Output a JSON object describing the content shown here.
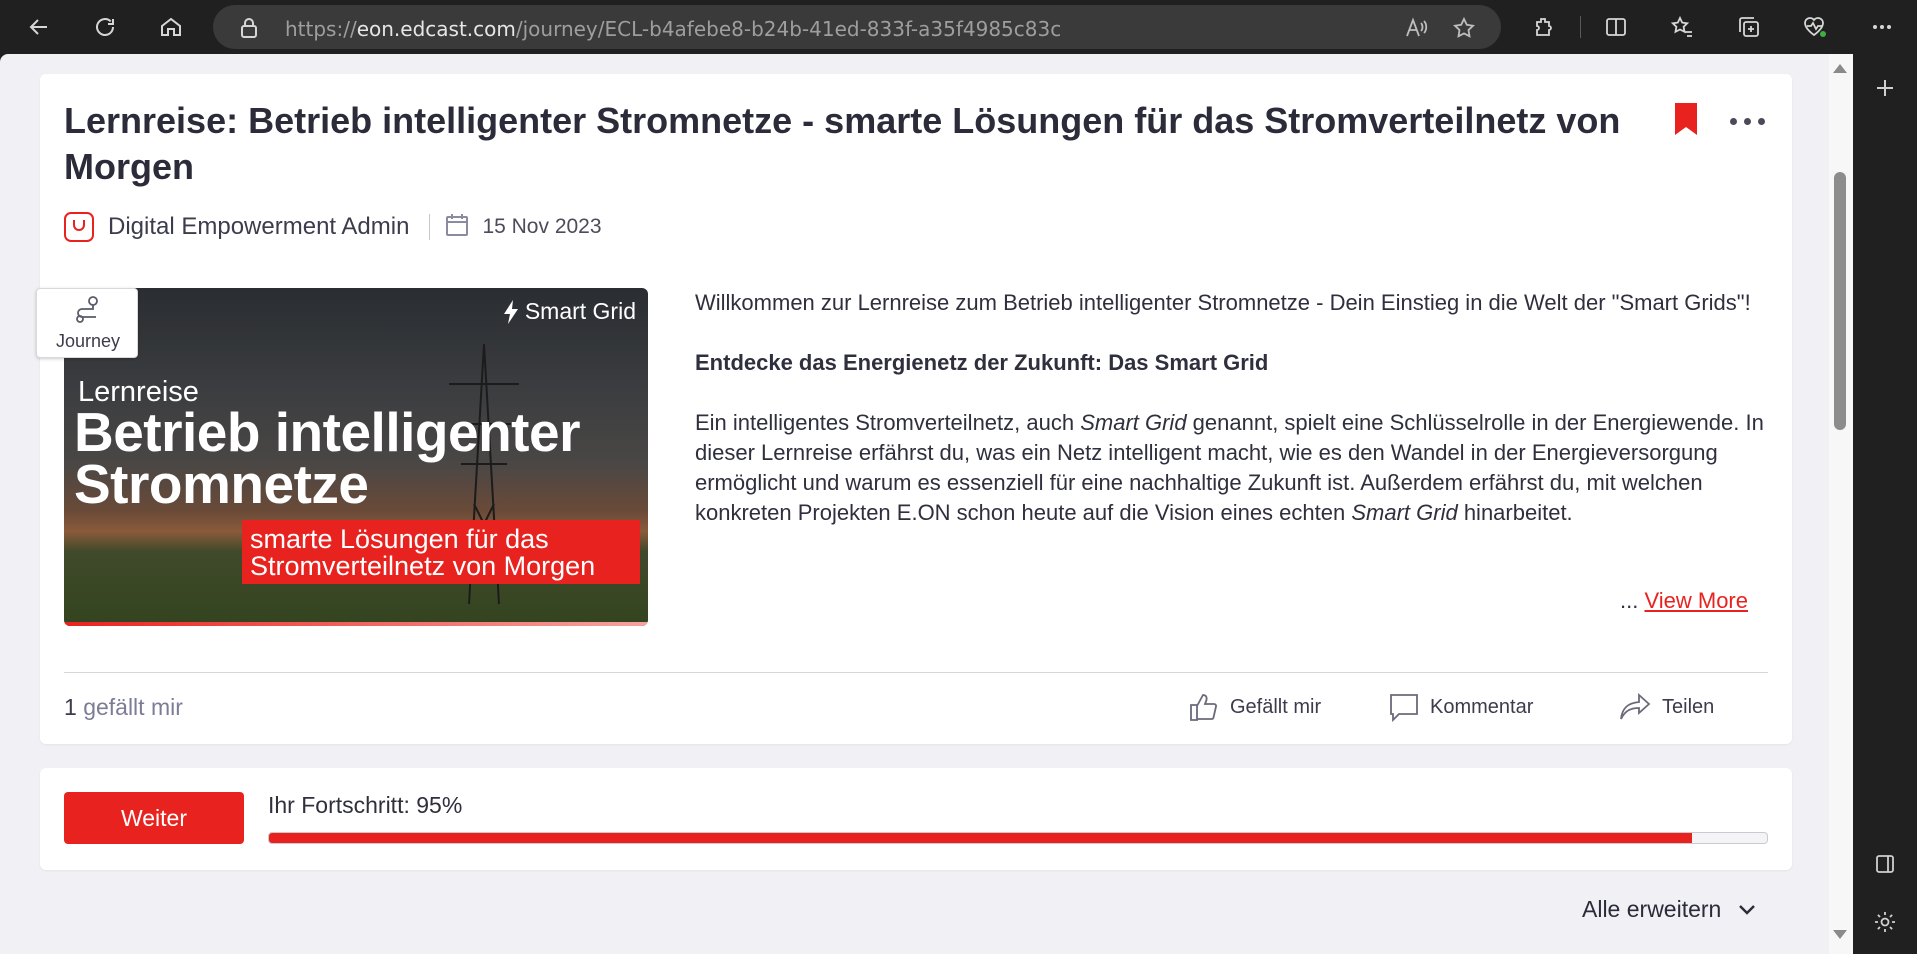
{
  "browser": {
    "url_prefix": "https://",
    "url_host": "eon.edcast.com",
    "url_path": "/journey/ECL-b4afebe8-b24b-41ed-833f-a35f4985c83c"
  },
  "card": {
    "title": "Lernreise: Betrieb intelligenter Stromnetze - smarte Lösungen für das Stromverteilnetz von Morgen",
    "author": "Digital Empowerment Admin",
    "date": "15 Nov 2023",
    "badge_label": "Journey",
    "accent_color": "#e8231f"
  },
  "hero": {
    "tag": "Smart Grid",
    "subtitle": "Lernreise",
    "headline_1": "Betrieb intelligenter",
    "headline_2": "Stromnetze",
    "red_line_1": "smarte Lösungen für das",
    "red_line_2": "Stromverteilnetz von Morgen"
  },
  "description": {
    "intro": "Willkommen zur Lernreise zum Betrieb intelligenter Stromnetze - Dein Einstieg in die Welt der \"Smart Grids\"!",
    "heading": "Entdecke das Energienetz der Zukunft: Das Smart Grid",
    "body_1": "Ein intelligentes Stromverteilnetz, auch ",
    "body_em_1": "Smart Grid",
    "body_2": " genannt, spielt eine Schlüsselrolle in der Energiewende. In dieser Lernreise erfährst du, was ein Netz intelligent macht, wie es den Wandel in der Energieversorgung ermöglicht und warum es essenziell für eine nachhaltige Zukunft ist. Außerdem erfährst du, mit welchen konkreten Projekten E.ON schon heute auf die Vision eines echten ",
    "body_em_2": "Smart Grid",
    "body_3": " hinarbeitet.",
    "ellipsis": "...",
    "view_more": "View More"
  },
  "engagement": {
    "like_count": "1",
    "like_suffix": "gefällt mir",
    "like_label": "Gefällt mir",
    "comment_label": "Kommentar",
    "share_label": "Teilen"
  },
  "progress": {
    "button_label": "Weiter",
    "label": "Ihr Fortschritt: 95%",
    "value_percent": 95
  },
  "footer": {
    "expand_all": "Alle erweitern"
  }
}
